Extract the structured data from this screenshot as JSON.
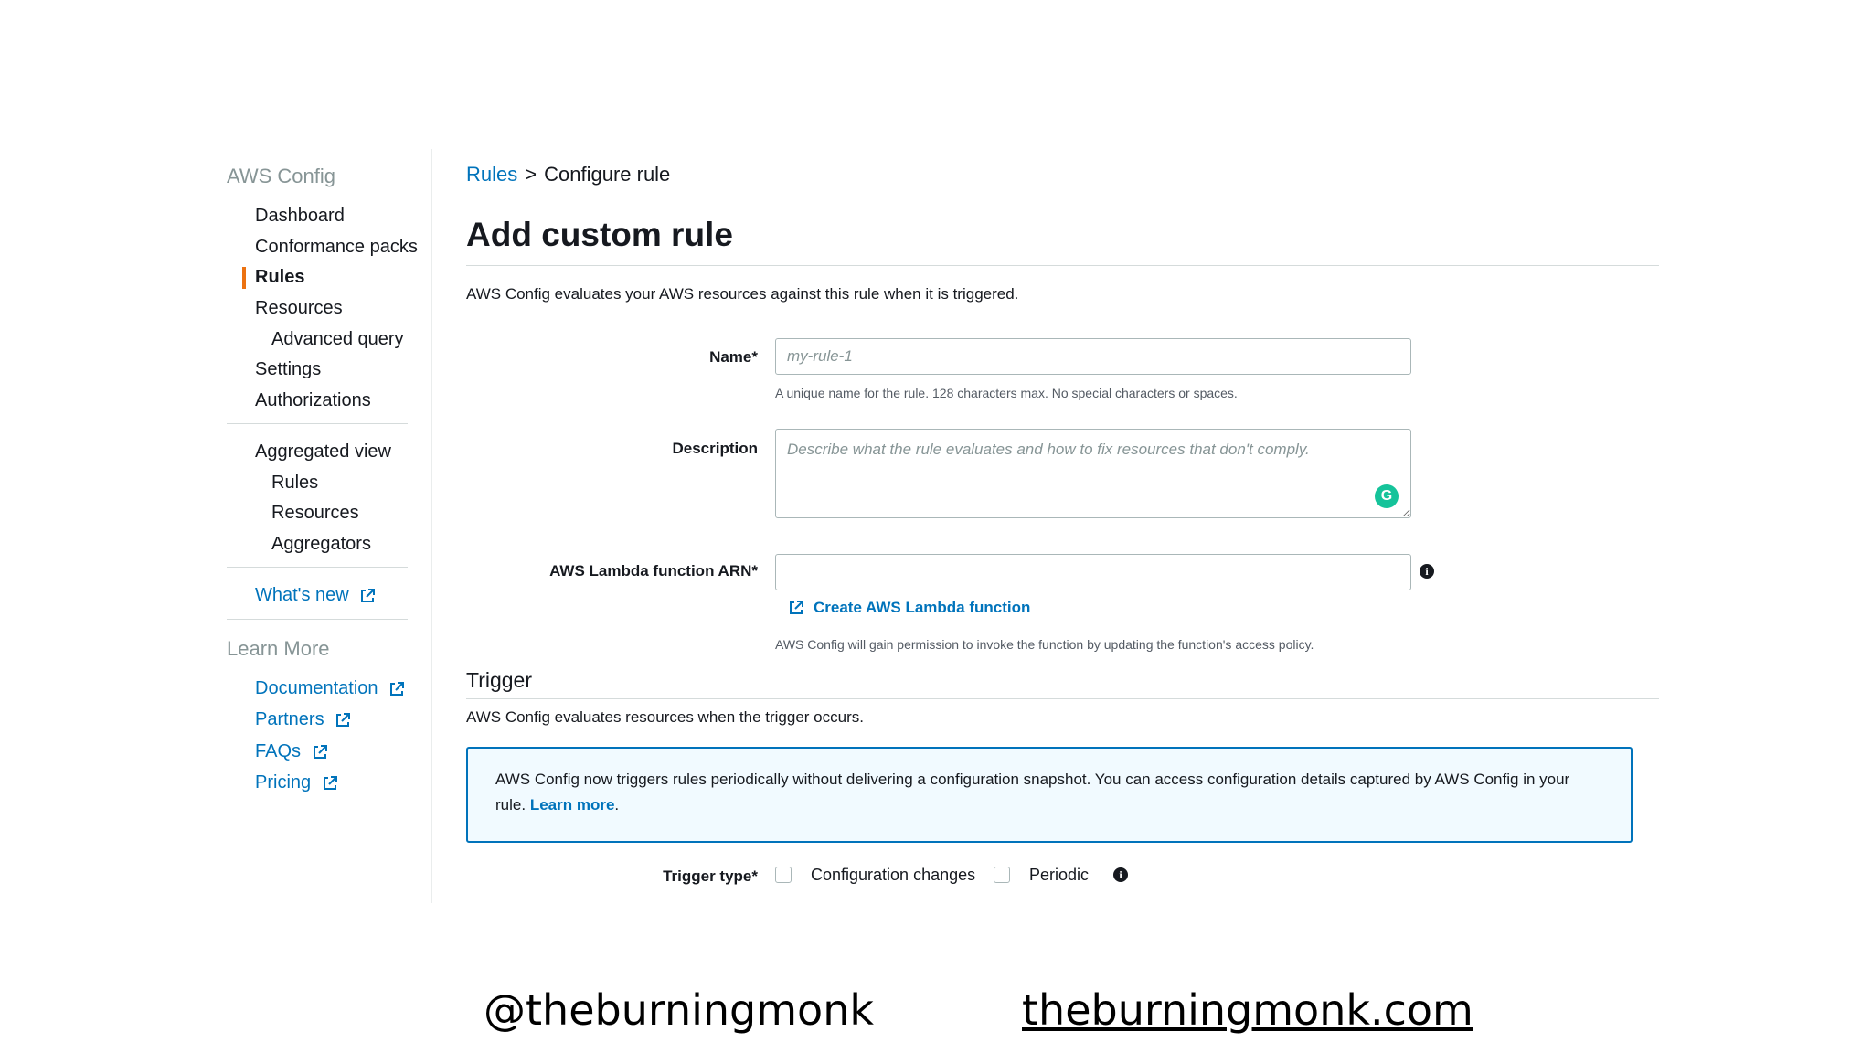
{
  "sidebar": {
    "title": "AWS Config",
    "items": [
      {
        "label": "Dashboard"
      },
      {
        "label": "Conformance packs"
      },
      {
        "label": "Rules"
      },
      {
        "label": "Resources"
      },
      {
        "label": "Advanced query"
      },
      {
        "label": "Settings"
      },
      {
        "label": "Authorizations"
      }
    ],
    "aggregated": {
      "label": "Aggregated view",
      "items": [
        {
          "label": "Rules"
        },
        {
          "label": "Resources"
        },
        {
          "label": "Aggregators"
        }
      ]
    },
    "whats_new": "What's new",
    "learn_more": {
      "title": "Learn More",
      "links": [
        {
          "label": "Documentation"
        },
        {
          "label": "Partners"
        },
        {
          "label": "FAQs"
        },
        {
          "label": "Pricing"
        }
      ]
    }
  },
  "breadcrumb": {
    "link": "Rules",
    "separator": ">",
    "current": "Configure rule"
  },
  "page": {
    "title": "Add custom rule",
    "description": "AWS Config evaluates your AWS resources against this rule when it is triggered."
  },
  "form": {
    "name": {
      "label": "Name*",
      "placeholder": "my-rule-1",
      "hint": "A unique name for the rule. 128 characters max. No special characters or spaces."
    },
    "description": {
      "label": "Description",
      "placeholder": "Describe what the rule evaluates and how to fix resources that don't comply."
    },
    "lambda": {
      "label": "AWS Lambda function ARN*",
      "value": "",
      "create_link": "Create AWS Lambda function",
      "hint": "AWS Config will gain permission to invoke the function by updating the function's access policy."
    }
  },
  "trigger": {
    "title": "Trigger",
    "description": "AWS Config evaluates resources when the trigger occurs.",
    "info_box": {
      "text": "AWS Config now triggers rules periodically without delivering a configuration snapshot. You can access configuration details captured by AWS Config in your rule.",
      "learn_more": "Learn more",
      "suffix": "."
    },
    "type_label": "Trigger type*",
    "options": [
      {
        "label": "Configuration changes"
      },
      {
        "label": "Periodic"
      }
    ]
  },
  "footer": {
    "handle": "@theburningmonk",
    "site": "theburningmonk.com"
  },
  "colors": {
    "accent": "#0073bb",
    "active_marker": "#ec7211",
    "grammarly": "#15c39a"
  },
  "icons": [
    "external-link-icon",
    "info-icon",
    "grammarly-icon"
  ]
}
